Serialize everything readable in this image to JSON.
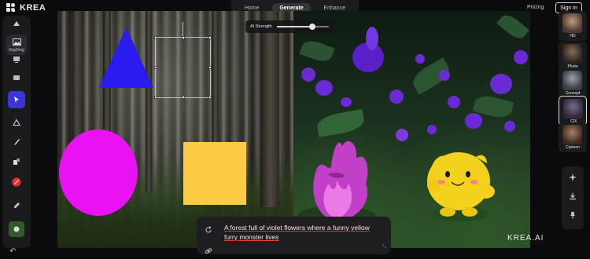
{
  "app": {
    "name": "KREA"
  },
  "nav": {
    "tabs": [
      {
        "label": "Home",
        "active": false
      },
      {
        "label": "Generate",
        "active": true
      },
      {
        "label": "Enhance",
        "active": false
      }
    ],
    "pricing": "Pricing",
    "sign_in": "Sign In"
  },
  "toolbar": {
    "items": [
      {
        "icon": "upload-icon"
      },
      {
        "icon": "image-icon",
        "label": "Img2Img"
      },
      {
        "icon": "screen-icon"
      },
      {
        "icon": "camera-icon"
      },
      {
        "icon": "cursor-icon",
        "active": true
      },
      {
        "icon": "triangle-icon"
      },
      {
        "icon": "brush-icon"
      },
      {
        "icon": "shapes-icon"
      },
      {
        "icon": "color-circle-icon",
        "color": "#e03030"
      },
      {
        "icon": "dropper-icon"
      },
      {
        "icon": "thumbnail-icon"
      }
    ],
    "undo_icon": "undo-icon"
  },
  "ai_strength": {
    "label": "AI Strength",
    "value": 0.68
  },
  "canvas": {
    "shapes": [
      {
        "type": "triangle",
        "color": "#2a1cf0"
      },
      {
        "type": "circle",
        "color": "#ea12f2"
      },
      {
        "type": "square",
        "color": "#fecb45"
      }
    ]
  },
  "prompt": {
    "text": "A forest full of violet flowers where a funny yellow furry monster lives"
  },
  "styles": [
    {
      "label": "HD",
      "colors": [
        "#c59a7a",
        "#4a3a30"
      ]
    },
    {
      "label": "Photo",
      "colors": [
        "#8a6a55",
        "#2a2420"
      ]
    },
    {
      "label": "Concept",
      "colors": [
        "#9aa0a8",
        "#3a3c44"
      ]
    },
    {
      "label": "C0l",
      "colors": [
        "#7a6a8a",
        "#30283a"
      ],
      "selected": true
    },
    {
      "label": "Cartoon",
      "colors": [
        "#b08060",
        "#3a2a20"
      ]
    }
  ],
  "right_tools": [
    "sparkle-icon",
    "download-icon",
    "pin-icon"
  ],
  "watermark": "KREA.AI",
  "colors": {
    "accent": "#3a35d8",
    "background": "#0b0b0d",
    "panel": "#1b1b1e"
  }
}
